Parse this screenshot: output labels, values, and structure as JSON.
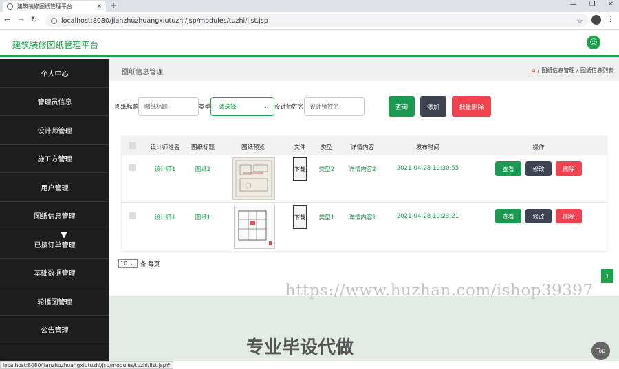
{
  "browser": {
    "tab_title": "建筑装修图纸管理平台",
    "url": "localhost:8080/jianzhuzhuangxiutuzhi/jsp/modules/tuzhi/list.jsp",
    "status_url": "localhost:8080/jianzhuzhuangxiutuzhi/jsp/modules/tuzhi/list.jsp#"
  },
  "app": {
    "title": "建筑装修图纸管理平台",
    "accent": "#1aa34a"
  },
  "sidebar": {
    "items": [
      {
        "label": "个人中心"
      },
      {
        "label": "管理员信息"
      },
      {
        "label": "设计师管理"
      },
      {
        "label": "施工方管理"
      },
      {
        "label": "用户管理"
      },
      {
        "label": "图纸信息管理"
      },
      {
        "label": "已接订单管理"
      },
      {
        "label": "基础数据管理"
      },
      {
        "label": "轮播图管理"
      },
      {
        "label": "公告管理"
      }
    ]
  },
  "page": {
    "heading": "图纸信息管理",
    "breadcrumb": [
      "图纸信息管理",
      "图纸信息列表"
    ]
  },
  "search": {
    "title_label": "图纸标题",
    "title_placeholder": "图纸标题",
    "type_label": "类型",
    "type_selected": "-请选择-",
    "designer_label": "设计师姓名",
    "designer_placeholder": "设计师姓名",
    "query_label": "查询",
    "add_label": "添加",
    "batch_delete_label": "批量删除"
  },
  "table": {
    "headers": [
      "设计师姓名",
      "图纸标题",
      "图纸预览",
      "文件",
      "类型",
      "详情内容",
      "发布时间",
      "操作"
    ],
    "rows": [
      {
        "designer": "设计师1",
        "title": "图纸2",
        "file": "下载",
        "type": "类型2",
        "detail": "详情内容2",
        "time": "2021-04-28 10:30:55"
      },
      {
        "designer": "设计师1",
        "title": "图纸1",
        "file": "下载",
        "type": "类型1",
        "detail": "详情内容1",
        "time": "2021-04-28 10:23:21"
      }
    ],
    "actions": {
      "view": "查看",
      "edit": "修改",
      "delete": "删除"
    }
  },
  "pagination": {
    "page_size": "10",
    "per_page_label": "条 每页",
    "current_page": "1"
  },
  "overlay": {
    "watermark": "https://www.huzhan.com/ishop39397",
    "promo": "专业毕设代做",
    "top_button": "Top"
  }
}
